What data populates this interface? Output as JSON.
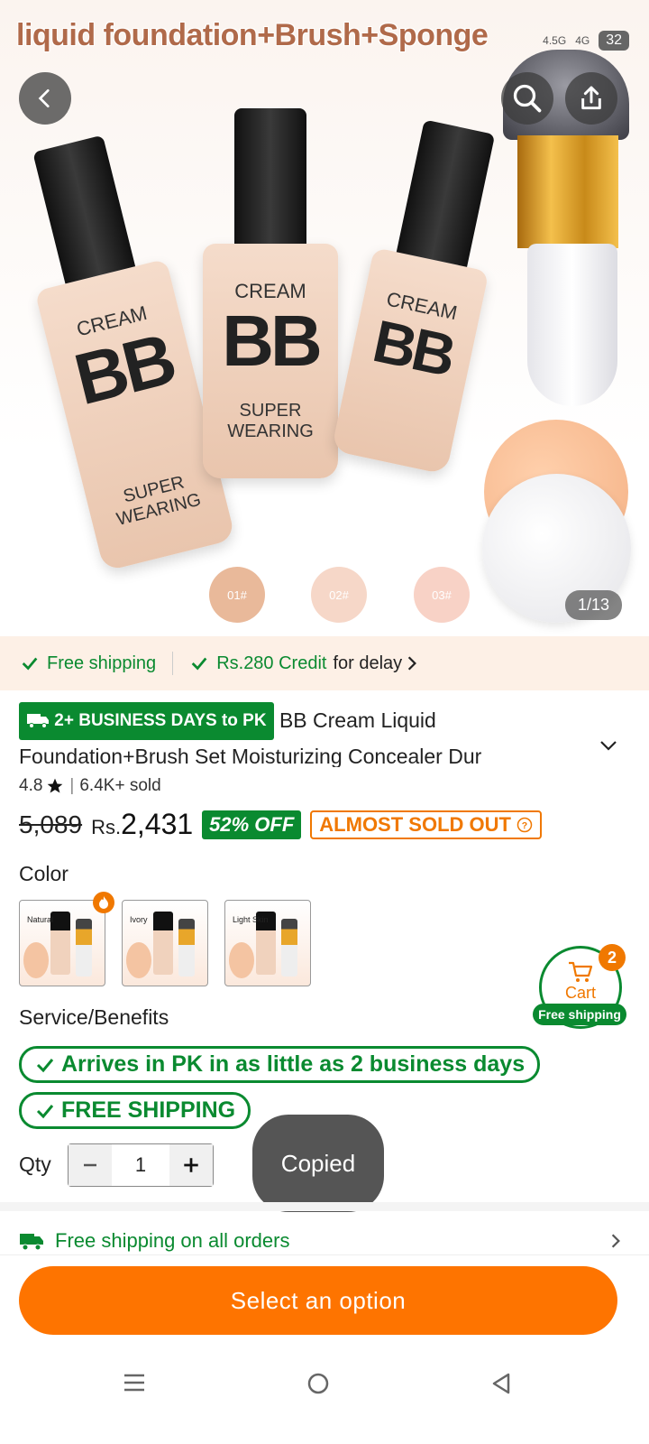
{
  "hero": {
    "overlay_title": "liquid foundation+Brush+Sponge",
    "status": {
      "net1": "4.5G",
      "net2": "4G",
      "battery": "32"
    },
    "bottle_cream": "CREAM",
    "bottle_bb": "BB",
    "bottle_bottom": "SUPER WEARING",
    "swatches": [
      "01#",
      "02#",
      "03#"
    ],
    "counter": "1/13"
  },
  "shipping_strip": {
    "free_shipping": "Free shipping",
    "credit": "Rs.280 Credit",
    "credit_suffix": "for delay"
  },
  "product": {
    "delivery_badge": "2+ BUSINESS DAYS to PK",
    "title": "BB Cream Liquid Foundation+Brush Set Moisturizing Concealer Dur",
    "rating": "4.8",
    "sold": "6.4K+ sold",
    "old_price": "5,089",
    "currency": "Rs.",
    "price": "2,431",
    "discount": "52% OFF",
    "stock_badge": "ALMOST SOLD OUT"
  },
  "color": {
    "label": "Color",
    "options": [
      "Natural",
      "Ivory",
      "Light Skin"
    ]
  },
  "service": {
    "label": "Service/Benefits",
    "benefit1": "Arrives in PK in as little as 2 business days",
    "benefit2": "FREE SHIPPING"
  },
  "qty": {
    "label": "Qty",
    "value": "1"
  },
  "toast": "Copied",
  "cart": {
    "label": "Cart",
    "count": "2",
    "ship_label": "Free shipping"
  },
  "free_shipping_row": "Free shipping on all orders",
  "cta": "Select an option",
  "colors": {
    "accent": "#fe7400",
    "green": "#0a8a30"
  }
}
